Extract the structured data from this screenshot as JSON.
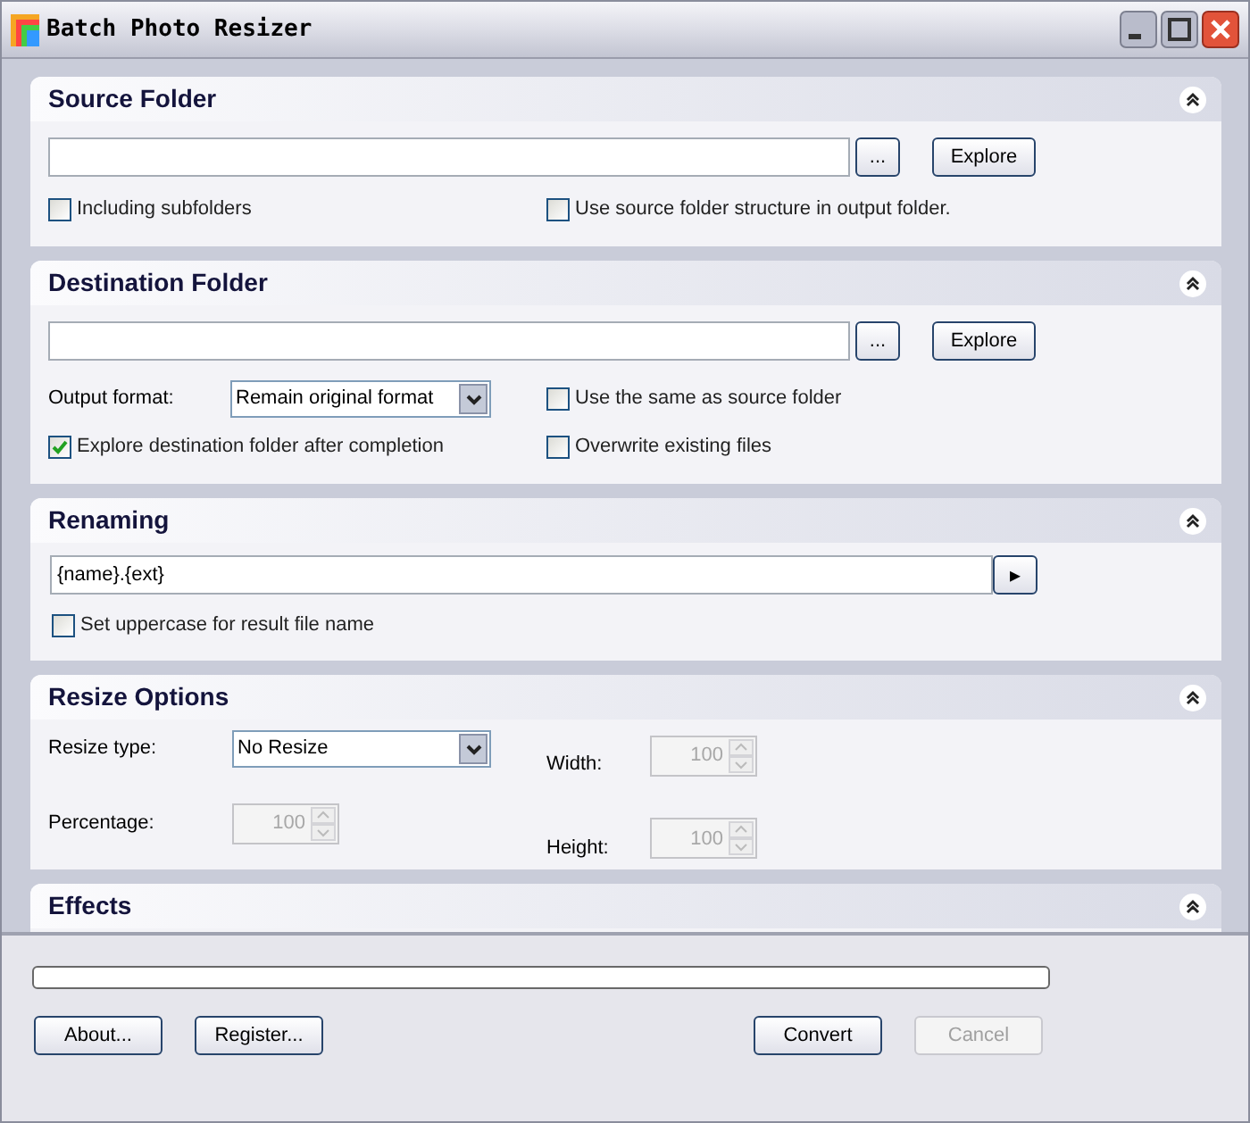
{
  "window": {
    "title": "Batch Photo Resizer"
  },
  "source_folder": {
    "title": "Source Folder",
    "browse_button": "...",
    "explore_button": "Explore",
    "checkboxes": [
      {
        "label": "Including subfolders",
        "checked": false
      },
      {
        "label": "Use source folder structure in output folder.",
        "checked": false
      }
    ]
  },
  "destination_folder": {
    "title": "Destination Folder",
    "browse_button": "...",
    "explore_button": "Explore",
    "output_format": {
      "label": "Output format:",
      "value": "Remain original format"
    },
    "checkboxes": [
      {
        "label": "Use the same as source folder",
        "checked": false
      },
      {
        "label": "Explore destination folder after completion",
        "checked": true
      },
      {
        "label": "Overwrite existing files",
        "checked": false
      }
    ]
  },
  "renaming": {
    "title": "Renaming",
    "pattern": "{name}.{ext}",
    "arrow_button": "▸",
    "checkboxes": [
      {
        "label": "Set uppercase for result file name",
        "checked": false
      }
    ]
  },
  "resize_options": {
    "title": "Resize Options",
    "resize_type": {
      "label": "Resize type:",
      "value": "No Resize"
    },
    "spinners": [
      {
        "label": "Width:",
        "value": "100",
        "disabled": true
      },
      {
        "label": "Percentage:",
        "value": "100",
        "disabled": true
      },
      {
        "label": "Height:",
        "value": "100",
        "disabled": true
      }
    ]
  },
  "effects": {
    "title": "Effects"
  },
  "progress": {
    "level": 0
  },
  "buttons": [
    {
      "label": "About...",
      "disabled": false
    },
    {
      "label": "Register...",
      "disabled": false
    },
    {
      "label": "Convert",
      "disabled": false
    },
    {
      "label": "Cancel",
      "disabled": true
    }
  ]
}
